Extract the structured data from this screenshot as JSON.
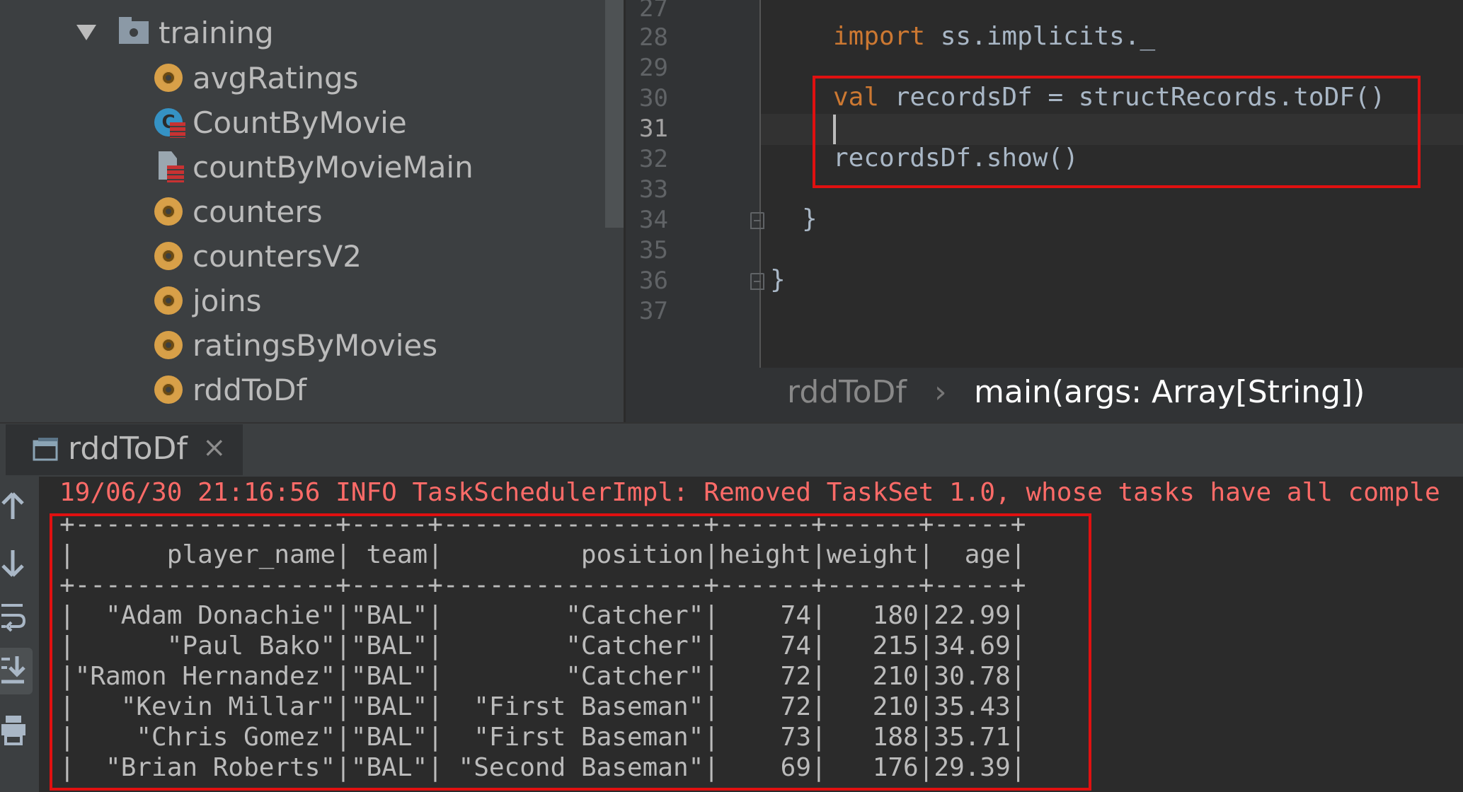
{
  "project_tree": {
    "folder": {
      "name": "training",
      "icon": "folder-icon"
    },
    "items": [
      {
        "label": "avgRatings",
        "icon": "scala-object-icon"
      },
      {
        "label": "CountByMovie",
        "icon": "scala-class-icon"
      },
      {
        "label": "countByMovieMain",
        "icon": "scala-file-icon"
      },
      {
        "label": "counters",
        "icon": "scala-object-icon"
      },
      {
        "label": "countersV2",
        "icon": "scala-object-icon"
      },
      {
        "label": "joins",
        "icon": "scala-object-icon"
      },
      {
        "label": "ratingsByMovies",
        "icon": "scala-object-icon"
      },
      {
        "label": "rddToDf",
        "icon": "scala-object-icon"
      }
    ]
  },
  "editor": {
    "line_numbers": [
      "27",
      "28",
      "29",
      "30",
      "31",
      "32",
      "33",
      "34",
      "35",
      "36",
      "37"
    ],
    "current_line": "31",
    "code": {
      "import_kw": "import",
      "import_rest": " ss.implicits._",
      "val_kw": "val",
      "val_rest": " recordsDf = structRecords.toDF()",
      "show_line": "recordsDf.show()",
      "close_inner": "}",
      "close_outer": "}"
    }
  },
  "breadcrumb": {
    "object": "rddToDf",
    "separator": "›",
    "method": "main(args: Array[String])"
  },
  "run_panel": {
    "tab_title": "rddToDf",
    "toolbar_icons": [
      "up-arrow-icon",
      "down-arrow-icon",
      "soft-wrap-icon",
      "scroll-to-end-icon",
      "print-icon"
    ],
    "console_lines": [
      "19/06/30 21:16:56 INFO TaskSchedulerImpl: Removed TaskSet 1.0, whose tasks have all comple",
      "+-----------------+-----+-----------------+------+------+-----+",
      "|      player_name| team|         position|height|weight|  age|",
      "+-----------------+-----+-----------------+------+------+-----+",
      "|  \"Adam Donachie\"|\"BAL\"|        \"Catcher\"|    74|   180|22.99|",
      "|      \"Paul Bako\"|\"BAL\"|        \"Catcher\"|    74|   215|34.69|",
      "|\"Ramon Hernandez\"|\"BAL\"|        \"Catcher\"|    72|   210|30.78|",
      "|   \"Kevin Millar\"|\"BAL\"|  \"First Baseman\"|    72|   210|35.43|",
      "|    \"Chris Gomez\"|\"BAL\"|  \"First Baseman\"|    73|   188|35.71|",
      "|  \"Brian Roberts\"|\"BAL\"| \"Second Baseman\"|    69|   176|29.39|"
    ]
  },
  "colors": {
    "highlight_box": "#e01010",
    "keyword": "#cc7832",
    "info_text": "#ff6b68"
  }
}
